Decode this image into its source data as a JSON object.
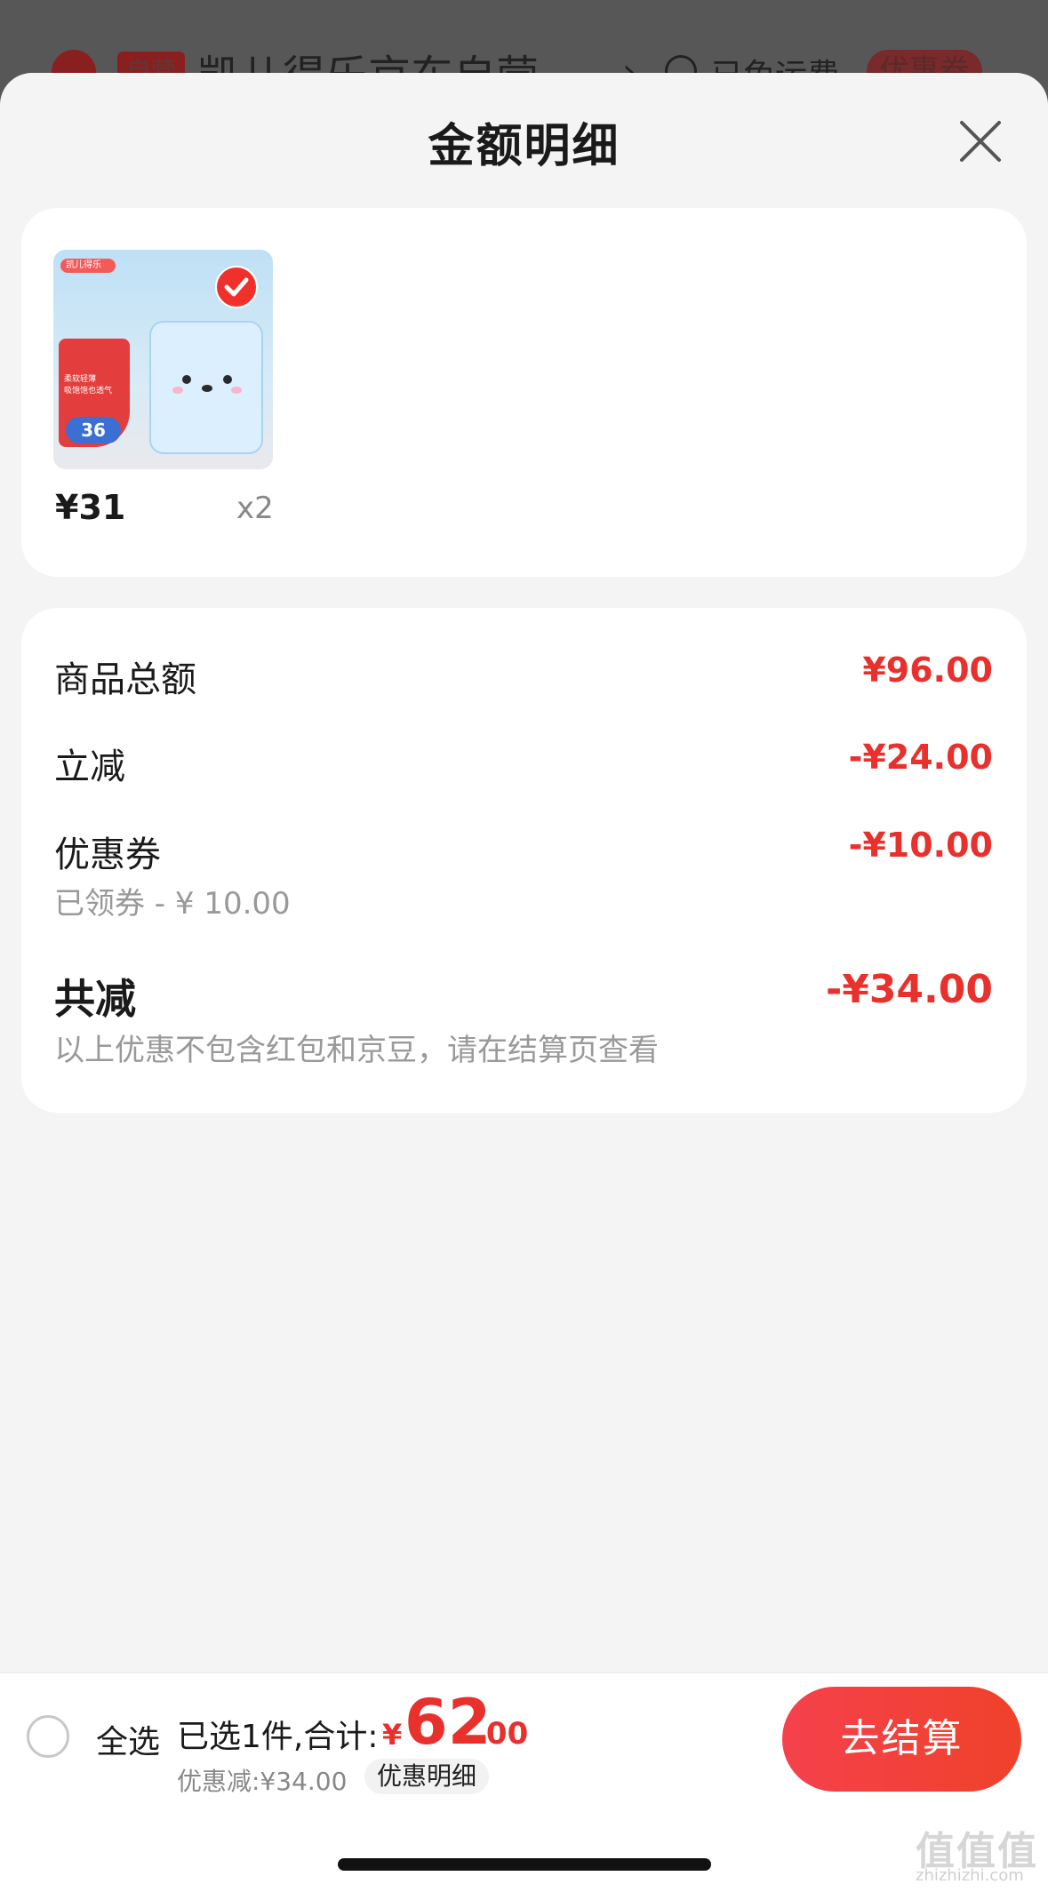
{
  "background_header": {
    "store_tag": "自营",
    "store_name": "凯儿得乐京东自营",
    "shipping": "已免运费",
    "coupon_badge": "优惠券"
  },
  "sheet": {
    "title": "金额明细",
    "close_icon": "close-icon"
  },
  "product": {
    "thumbnail_alt": "diaper-pack-image",
    "thumb_brand": "凯儿得乐",
    "thumb_text_1": "柔软轻薄",
    "thumb_text_2": "吸饱饱也透气",
    "thumb_price": "36",
    "price": "¥31",
    "quantity": "x2",
    "selected": true
  },
  "summary": {
    "items_total_label": "商品总额",
    "items_total_value": "¥96.00",
    "instant_discount_label": "立减",
    "instant_discount_value": "-¥24.00",
    "coupon_label": "优惠券",
    "coupon_value": "-¥10.00",
    "coupon_note": "已领券 - ¥ 10.00",
    "total_discount_label": "共减",
    "total_discount_value": "-¥34.00",
    "total_discount_note": "以上优惠不包含红包和京豆，请在结算页查看"
  },
  "bottom_bar": {
    "select_all": "全选",
    "selected_count": "已选1件,合计:",
    "total_symbol": "¥",
    "total_int": "62",
    "total_dec": ".00",
    "discount_text": "优惠减:¥34.00",
    "detail_button": "优惠明细",
    "checkout_button": "去结算"
  },
  "watermark": {
    "text": "值值值",
    "url": "zhizhizhi.com"
  },
  "colors": {
    "accent": "#e8302c",
    "sheet_bg": "#f4f4f4",
    "card_bg": "#ffffff"
  }
}
